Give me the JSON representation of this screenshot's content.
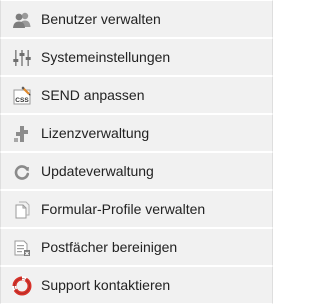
{
  "menu": {
    "items": [
      {
        "label": "Benutzer verwalten",
        "icon": "users-icon"
      },
      {
        "label": "Systemeinstellungen",
        "icon": "sliders-icon"
      },
      {
        "label": "SEND anpassen",
        "icon": "css-edit-icon"
      },
      {
        "label": "Lizenzverwaltung",
        "icon": "license-icon"
      },
      {
        "label": "Updateverwaltung",
        "icon": "refresh-icon"
      },
      {
        "label": "Formular-Profile verwalten",
        "icon": "documents-icon"
      },
      {
        "label": "Postfächer bereinigen",
        "icon": "mailbox-clean-icon"
      },
      {
        "label": "Support kontaktieren",
        "icon": "lifebuoy-icon"
      }
    ]
  },
  "colors": {
    "item_background": "#f1f1f1",
    "text": "#222222",
    "icon_gray": "#8a8a8a",
    "lifebuoy_red": "#d8322a"
  }
}
